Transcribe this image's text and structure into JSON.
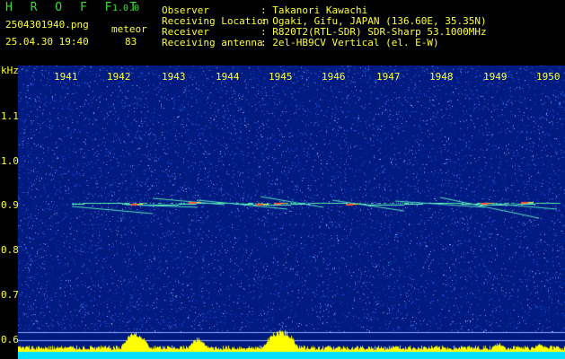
{
  "header": {
    "app_title": "H R O F F T",
    "app_version": "1.0.0",
    "filename": "2504301940.png",
    "mode": "meteor",
    "datetime": "25.04.30 19:40",
    "count": "83",
    "info": [
      {
        "label": "Observer",
        "value": ": Takanori Kawachi"
      },
      {
        "label": "Receiving Location",
        "value": ": Ogaki, Gifu, JAPAN (136.60E, 35.35N)"
      },
      {
        "label": "Receiver",
        "value": ": R820T2(RTL-SDR) SDR-Sharp 53.1000MHz"
      },
      {
        "label": "Receiving antenna",
        "value": ": 2el-HB9CV Vertical (el. E-W)"
      }
    ]
  },
  "spectrogram": {
    "unit_label": "kHz",
    "time_ticks": [
      "1941",
      "1942",
      "1943",
      "1944",
      "1945",
      "1946",
      "1947",
      "1948",
      "1949",
      "1950"
    ],
    "freq_ticks": [
      "1.1",
      "1.0",
      "0.9",
      "0.8",
      "0.7",
      "0.6"
    ],
    "colors": {
      "background": "#001a80",
      "trace": "#66ffcc",
      "bars": "#ffff00",
      "floor": "#00e0ff"
    }
  }
}
